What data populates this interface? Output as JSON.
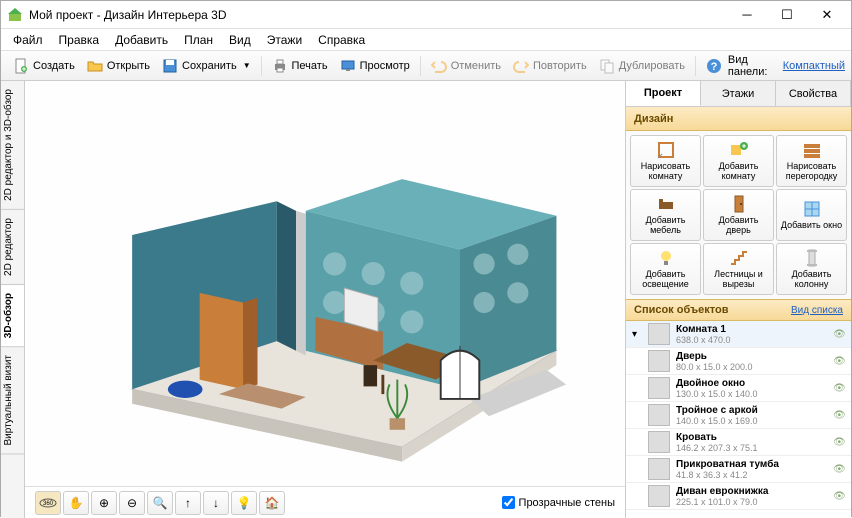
{
  "window": {
    "title": "Мой проект - Дизайн Интерьера 3D"
  },
  "menu": [
    "Файл",
    "Правка",
    "Добавить",
    "План",
    "Вид",
    "Этажи",
    "Справка"
  ],
  "toolbar": {
    "create": "Создать",
    "open": "Открыть",
    "save": "Сохранить",
    "print": "Печать",
    "preview": "Просмотр",
    "undo": "Отменить",
    "redo": "Повторить",
    "duplicate": "Дублировать",
    "panel_label": "Вид панели:",
    "panel_mode": "Компактный"
  },
  "sidetabs": {
    "t0": "2D редактор и 3D-обзор",
    "t1": "2D редактор",
    "t2": "3D-обзор",
    "t3": "Виртуальный визит"
  },
  "viewport": {
    "transparent_walls": "Прозрачные стены"
  },
  "right": {
    "tabs": {
      "project": "Проект",
      "floors": "Этажи",
      "props": "Свойства"
    },
    "design_header": "Дизайн",
    "btns": {
      "draw_room": "Нарисовать комнату",
      "add_room": "Добавить комнату",
      "draw_wall": "Нарисовать перегородку",
      "add_furn": "Добавить мебель",
      "add_door": "Добавить дверь",
      "add_window": "Добавить окно",
      "add_light": "Добавить освещение",
      "stairs": "Лестницы и вырезы",
      "add_column": "Добавить колонну"
    },
    "list_header": "Список объектов",
    "list_viewmode": "Вид списка"
  },
  "objects": [
    {
      "name": "Комната 1",
      "dim": "638.0 x 470.0",
      "root": true
    },
    {
      "name": "Дверь",
      "dim": "80.0 x 15.0 x 200.0"
    },
    {
      "name": "Двойное окно",
      "dim": "130.0 x 15.0 x 140.0"
    },
    {
      "name": "Тройное с аркой",
      "dim": "140.0 x 15.0 x 169.0"
    },
    {
      "name": "Кровать",
      "dim": "146.2 x 207.3 x 75.1"
    },
    {
      "name": "Прикроватная тумба",
      "dim": "41.8 x 36.3 x 41.2"
    },
    {
      "name": "Диван еврокнижка",
      "dim": "225.1 x 101.0 x 79.0"
    }
  ]
}
